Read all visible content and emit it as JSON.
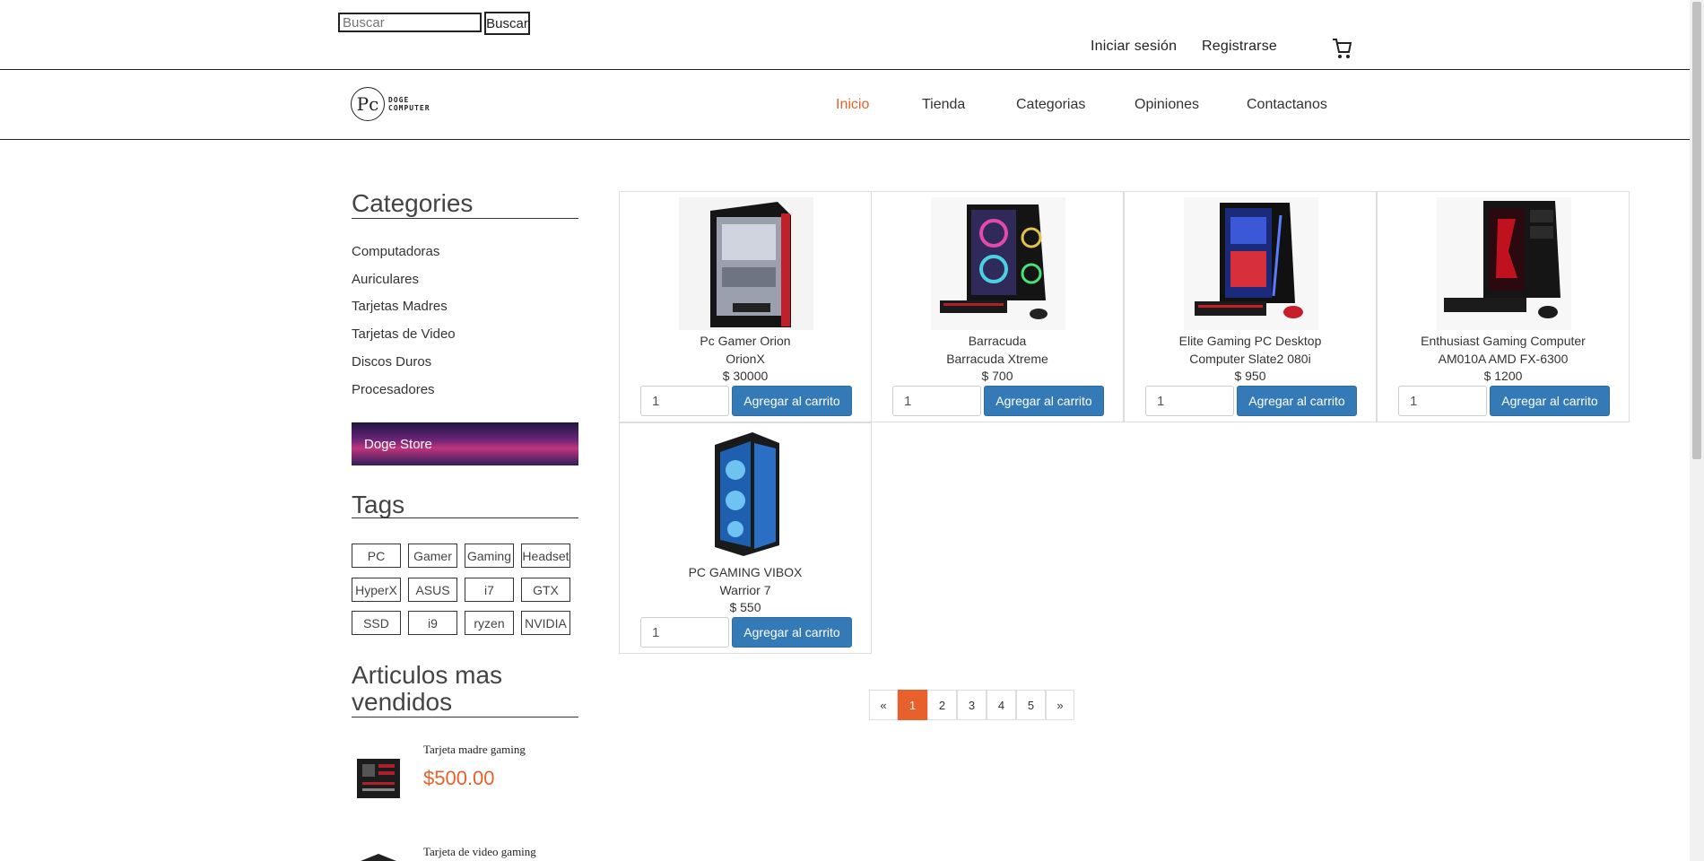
{
  "topbar": {
    "search_placeholder": "Buscar",
    "search_button": "Buscar",
    "login_link": "Iniciar sesión",
    "register_link": "Registrarse",
    "cart_icon": "cart-icon"
  },
  "header": {
    "logo_letters": "Pc",
    "logo_line1": "DOGE",
    "logo_line2": "COMPUTER",
    "nav": [
      "Inicio",
      "Tienda",
      "Categorias",
      "Opiniones",
      "Contactanos"
    ],
    "active_nav": "Inicio"
  },
  "sidebar": {
    "categories_title": "Categories",
    "categories": [
      "Computadoras",
      "Auriculares",
      "Tarjetas Madres",
      "Tarjetas de Video",
      "Discos Duros",
      "Procesadores"
    ],
    "banner_text": "Doge Store",
    "tags_title": "Tags",
    "tags": [
      "PC",
      "Gamer",
      "Gaming",
      "Headset",
      "HyperX",
      "ASUS",
      "i7",
      "GTX",
      "SSD",
      "i9",
      "ryzen",
      "NVIDIA"
    ],
    "best_title": "Articulos mas vendidos",
    "best_sellers": [
      {
        "name": "Tarjeta madre gaming",
        "price": "$500.00"
      },
      {
        "name": "Tarjeta de video gaming",
        "price": ""
      }
    ]
  },
  "products": [
    {
      "line1": "Pc Gamer Orion",
      "line2": "OrionX",
      "price": "$ 30000",
      "qty": "1",
      "button": "Agregar al carrito"
    },
    {
      "line1": "Barracuda",
      "line2": "Barracuda Xtreme",
      "price": "$ 700",
      "qty": "1",
      "button": "Agregar al carrito"
    },
    {
      "line1": "Elite Gaming PC Desktop",
      "line2": "Computer Slate2 080i",
      "price": "$ 950",
      "qty": "1",
      "button": "Agregar al carrito"
    },
    {
      "line1": "Enthusiast Gaming Computer",
      "line2": "AM010A AMD FX-6300",
      "price": "$ 1200",
      "qty": "1",
      "button": "Agregar al carrito"
    },
    {
      "line1": "PC GAMING VIBOX",
      "line2": "Warrior 7",
      "price": "$ 550",
      "qty": "1",
      "button": "Agregar al carrito"
    }
  ],
  "pagination": {
    "prev": "«",
    "pages": [
      "1",
      "2",
      "3",
      "4",
      "5"
    ],
    "next": "»",
    "current": "1"
  },
  "colors": {
    "accent": "#e8602c",
    "button_blue": "#337ab7"
  }
}
